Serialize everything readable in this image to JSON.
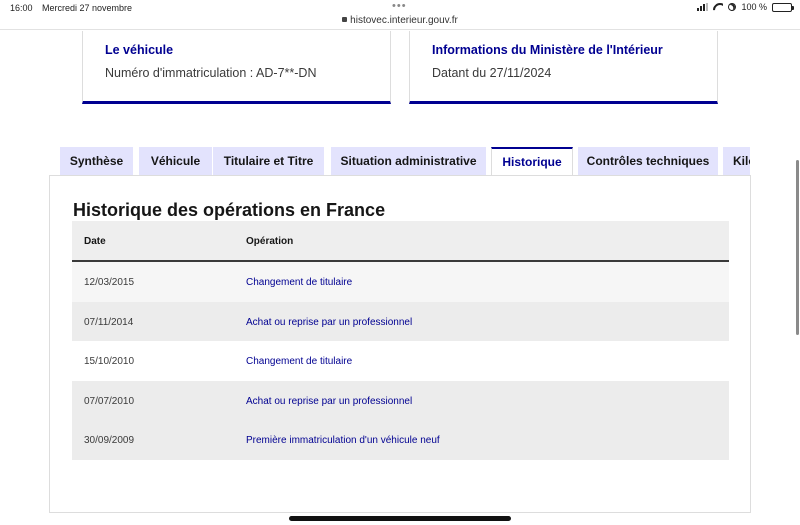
{
  "status_bar": {
    "time": "16:00",
    "date": "Mercredi 27 novembre",
    "url": "histovec.interieur.gouv.fr",
    "battery": "100 %"
  },
  "cards": [
    {
      "title": "Le véhicule",
      "text": "Numéro d'immatriculation : AD-7**-DN"
    },
    {
      "title": "Informations du Ministère de l'Intérieur",
      "text": "Datant du 27/11/2024"
    }
  ],
  "tabs": [
    {
      "label": "Synthèse"
    },
    {
      "label": "Véhicule"
    },
    {
      "label": "Titulaire et Titre"
    },
    {
      "label": "Situation administrative"
    },
    {
      "label": "Historique"
    },
    {
      "label": "Contrôles techniques"
    },
    {
      "label": "Kilométrage"
    }
  ],
  "active_tab": "Historique",
  "history": {
    "title": "Historique des opérations en France",
    "columns": {
      "date": "Date",
      "operation": "Opération"
    },
    "rows": [
      {
        "date": "12/03/2015",
        "operation": "Changement de titulaire"
      },
      {
        "date": "07/11/2014",
        "operation": "Achat ou reprise par un professionnel"
      },
      {
        "date": "15/10/2010",
        "operation": "Changement de titulaire"
      },
      {
        "date": "07/07/2010",
        "operation": "Achat ou reprise par un professionnel"
      },
      {
        "date": "30/09/2009",
        "operation": "Première immatriculation d'un véhicule neuf"
      }
    ]
  },
  "colors": {
    "accent": "#000091",
    "tab_background": "#e3e3fd",
    "row_alt": "#f0f0f0"
  }
}
